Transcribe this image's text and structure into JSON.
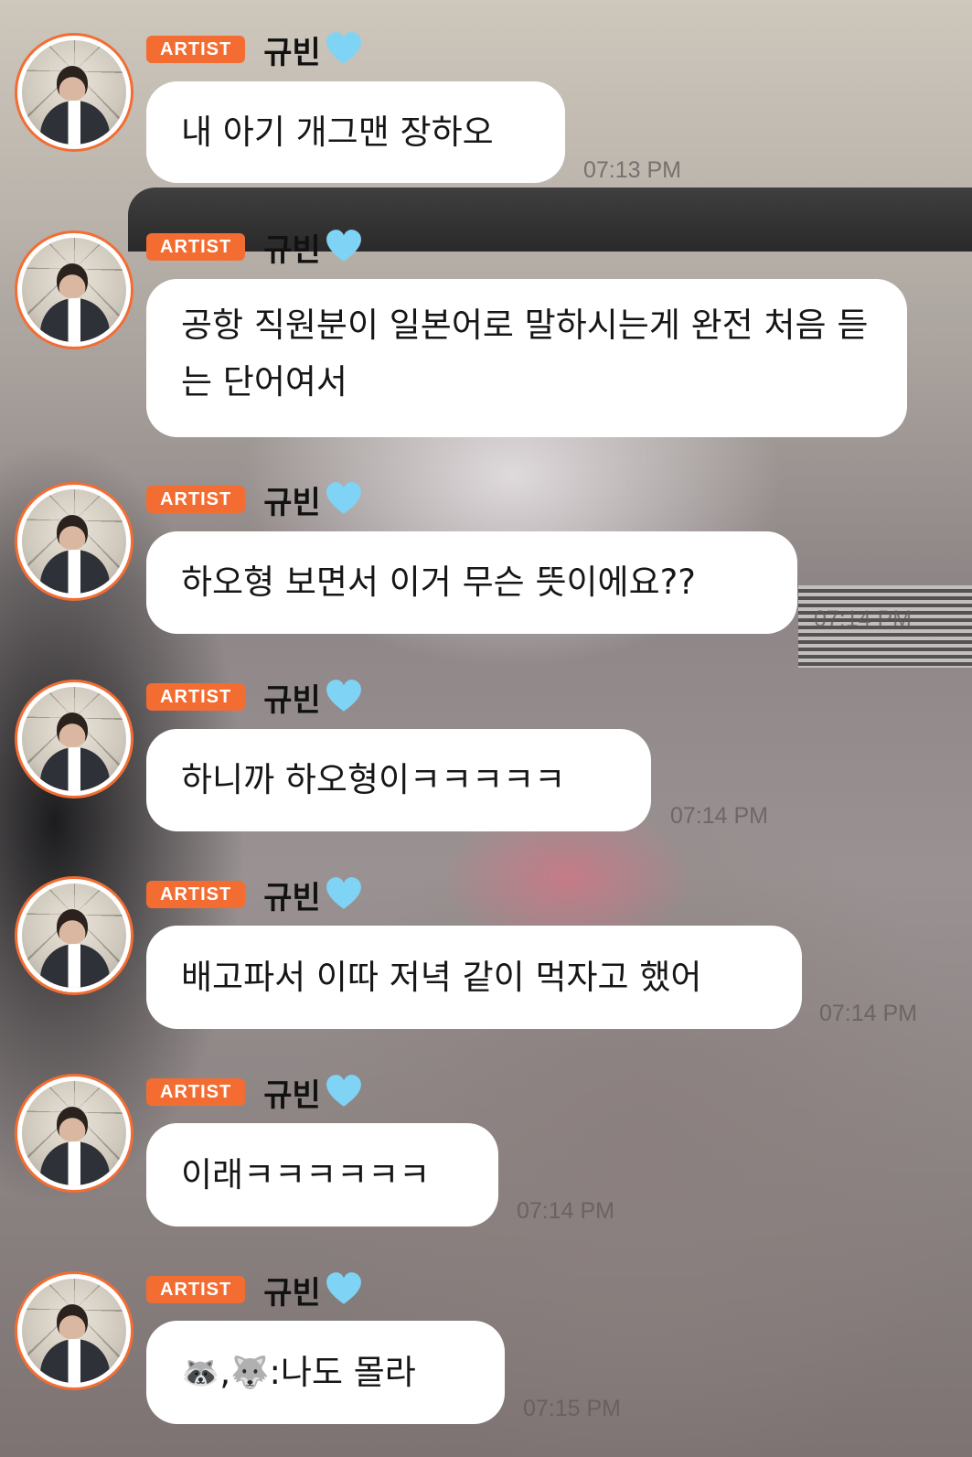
{
  "chat": {
    "messages": [
      {
        "badge": "ARTIST",
        "name": "규빈",
        "heart": "light-blue-heart-emoji",
        "text": "내 아기 개그맨 장하오",
        "time": "07:13 PM"
      },
      {
        "badge": "ARTIST",
        "name": "규빈",
        "heart": "light-blue-heart-emoji",
        "text": "공항 직원분이 일본어로 말하시는게 완전 처음 듣는 단어여서",
        "time": ""
      },
      {
        "badge": "ARTIST",
        "name": "규빈",
        "heart": "light-blue-heart-emoji",
        "text": "하오형 보면서 이거 무슨 뜻이에요??",
        "time": "07:14 PM"
      },
      {
        "badge": "ARTIST",
        "name": "규빈",
        "heart": "light-blue-heart-emoji",
        "text": "하니까 하오형이ㅋㅋㅋㅋㅋ",
        "time": "07:14 PM"
      },
      {
        "badge": "ARTIST",
        "name": "규빈",
        "heart": "light-blue-heart-emoji",
        "text": "배고파서 이따 저녁 같이 먹자고 했어",
        "time": "07:14 PM"
      },
      {
        "badge": "ARTIST",
        "name": "규빈",
        "heart": "light-blue-heart-emoji",
        "text": "이래ㅋㅋㅋㅋㅋㅋ",
        "time": "07:14 PM"
      },
      {
        "badge": "ARTIST",
        "name": "규빈",
        "heart": "light-blue-heart-emoji",
        "text_parts": [
          "🦝",
          ",",
          "🐺",
          ":나도 몰라"
        ],
        "time": "07:15 PM"
      }
    ]
  },
  "colors": {
    "badge": "#f36d33",
    "avatar_ring": "#f36d33",
    "bubble": "#ffffff",
    "heart": "#7fd3f5"
  }
}
